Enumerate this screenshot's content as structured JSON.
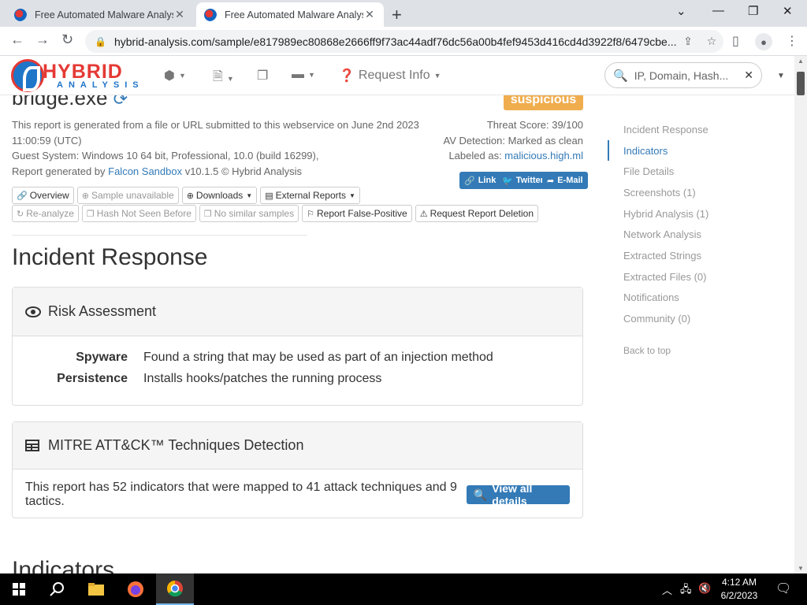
{
  "browser": {
    "tabs": [
      {
        "title": "Free Automated Malware Analysis",
        "active": false
      },
      {
        "title": "Free Automated Malware Analysis",
        "active": true
      }
    ],
    "url": "hybrid-analysis.com/sample/e817989ec80868e2666ff9f73ac44adf76dc56a00b4fef9453d416cd4d3922f8/6479cbe..."
  },
  "site": {
    "logo_top": "HYBRID",
    "logo_bottom": "ANALYSIS",
    "nav": {
      "request_info": "Request Info"
    },
    "search": {
      "placeholder": "IP, Domain, Hash..."
    }
  },
  "report": {
    "filename": "bridge.exe",
    "verdict": "suspicious",
    "verdict_color": "#f0ad4e",
    "intro": "This report is generated from a file or URL submitted to this webservice on June 2nd 2023",
    "time": "11:00:59 (UTC)",
    "guest": "Guest System: Windows 10 64 bit, Professional, 10.0 (build 16299),",
    "generated_prefix": "Report generated by ",
    "generator": "Falcon Sandbox",
    "generator_suffix": " v10.1.5 © Hybrid Analysis",
    "threat_score": "Threat Score: 39/100",
    "av_detection": "AV Detection: Marked as clean",
    "labeled_prefix": "Labeled as: ",
    "label": "malicious.high.ml",
    "share": {
      "link": "Link",
      "twitter": "Twitter",
      "email": "E-Mail"
    }
  },
  "buttons": {
    "overview": "Overview",
    "sample_unavailable": "Sample unavailable",
    "downloads": "Downloads",
    "external_reports": "External Reports",
    "reanalyze": "Re-analyze",
    "hash_not_seen": "Hash Not Seen Before",
    "no_similar": "No similar samples",
    "report_false_positive": "Report False-Positive",
    "request_deletion": "Request Report Deletion"
  },
  "incident": {
    "heading": "Incident Response",
    "risk": {
      "title": "Risk Assessment",
      "rows": [
        {
          "key": "Spyware",
          "value": "Found a string that may be used as part of an injection method"
        },
        {
          "key": "Persistence",
          "value": "Installs hooks/patches the running process"
        }
      ]
    },
    "mitre": {
      "title": "MITRE ATT&CK™ Techniques Detection",
      "text": "This report has 52 indicators that were mapped to 41 attack techniques and 9 tactics.",
      "button": "View all details"
    }
  },
  "indicators_heading": "Indicators",
  "sidenav": {
    "items": [
      {
        "label": "Incident Response",
        "active": false
      },
      {
        "label": "Indicators",
        "active": true
      },
      {
        "label": "File Details",
        "active": false
      },
      {
        "label": "Screenshots (1)",
        "active": false
      },
      {
        "label": "Hybrid Analysis (1)",
        "active": false
      },
      {
        "label": "Network Analysis",
        "active": false
      },
      {
        "label": "Extracted Strings",
        "active": false
      },
      {
        "label": "Extracted Files (0)",
        "active": false
      },
      {
        "label": "Notifications",
        "active": false
      },
      {
        "label": "Community (0)",
        "active": false
      }
    ],
    "back_to_top": "Back to top"
  },
  "taskbar": {
    "time": "4:12 AM",
    "date": "6/2/2023"
  }
}
